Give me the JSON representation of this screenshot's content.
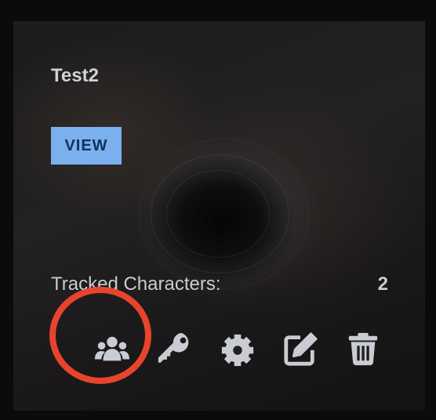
{
  "card": {
    "title": "Test2",
    "view_label": "VIEW",
    "tracked_label": "Tracked Characters:",
    "tracked_count": "2"
  },
  "actions": [
    {
      "icon": "users-icon"
    },
    {
      "icon": "key-icon"
    },
    {
      "icon": "gear-icon"
    },
    {
      "icon": "edit-icon"
    },
    {
      "icon": "trash-icon"
    }
  ],
  "colors": {
    "accent": "#7ab0ee",
    "icon": "#c9ccd2",
    "highlight": "#e8442d"
  }
}
